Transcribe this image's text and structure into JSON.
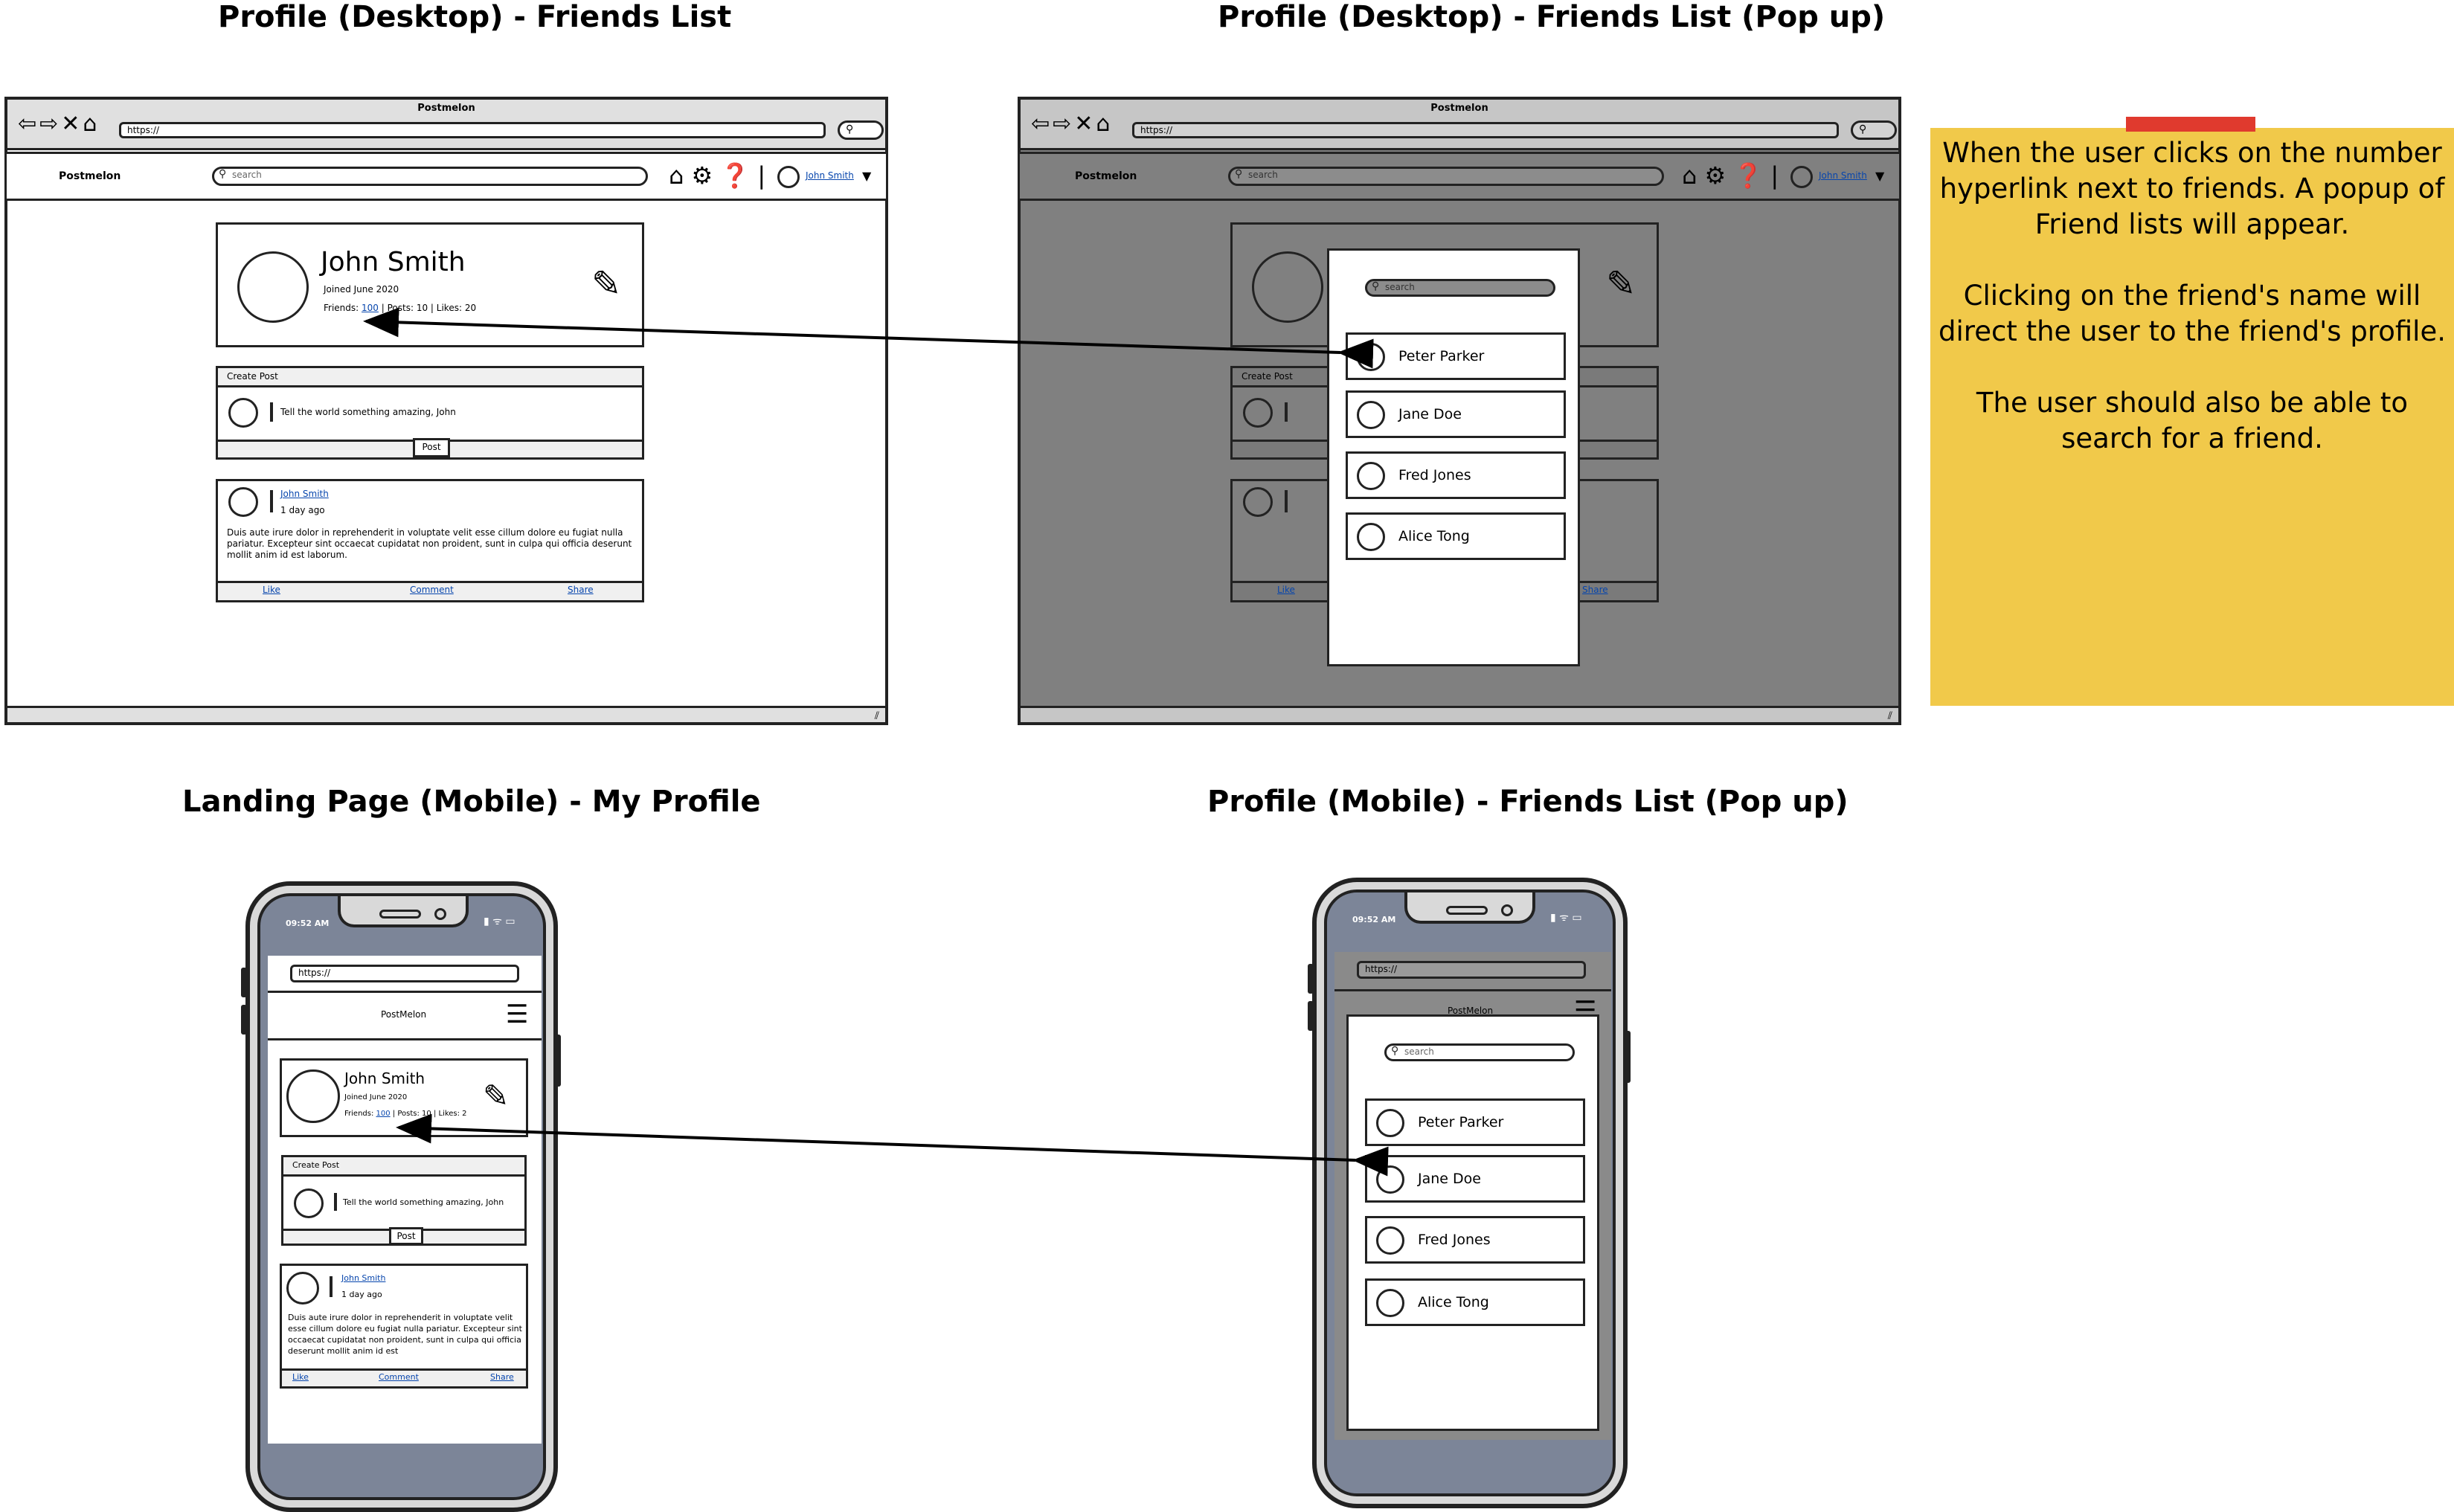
{
  "titles": {
    "desktop_profile": "Profile (Desktop) - Friends List",
    "desktop_popup": "Profile (Desktop) - Friends List (Pop up)",
    "mobile_profile": "Landing Page (Mobile) - My Profile",
    "mobile_popup": "Profile (Mobile) - Friends List (Pop up)"
  },
  "browser": {
    "app_name": "Postmelon",
    "url": "https://",
    "nav_buttons": "⇦⇨✕⌂",
    "brand": "Postmelon",
    "search_placeholder": "search",
    "nav_icons": "⌂ ⚙ ❓ |",
    "user_link": "John Smith",
    "caret": "▼"
  },
  "profile": {
    "name": "John Smith",
    "joined": "Joined June 2020",
    "friends_label": "Friends:",
    "friends_count": "100",
    "stats_rest": "| Posts: 10 | Likes: 20",
    "stats_rest_mobile": "| Posts: 10 | Likes: 2",
    "edit_icon": "✎"
  },
  "create_post": {
    "header": "Create Post",
    "placeholder": "Tell the world something amazing, John",
    "button": "Post"
  },
  "post": {
    "author": "John Smith",
    "time": "1 day ago",
    "body": "Duis aute irure dolor in reprehenderit in voluptate velit esse cillum dolore eu fugiat nulla pariatur. Excepteur sint occaecat cupidatat non proident, sunt in culpa qui officia deserunt mollit anim id est laborum.",
    "body_mobile": "Duis aute irure dolor in reprehenderit in voluptate velit esse cillum dolore eu fugiat nulla pariatur. Excepteur sint occaecat cupidatat non proident, sunt in culpa qui officia deserunt mollit anim id est",
    "like": "Like",
    "comment": "Comment",
    "share": "Share"
  },
  "popup": {
    "search_placeholder": "search",
    "friends": [
      "Peter Parker",
      "Jane Doe",
      "Fred Jones",
      "Alice Tong"
    ]
  },
  "phone": {
    "time": "09:52 AM",
    "signal": "▮ ᯤ ▭",
    "url": "https://",
    "brand": "PostMelon",
    "menu_icon": "☰"
  },
  "note": {
    "lines": [
      "When the user clicks on the number",
      "hyperlink next to friends. A popup of",
      "Friend lists will appear.",
      "",
      "Clicking on the friend's name will",
      "direct the user to the friend's profile.",
      "",
      "The user should also be able to",
      "search for a friend."
    ]
  }
}
